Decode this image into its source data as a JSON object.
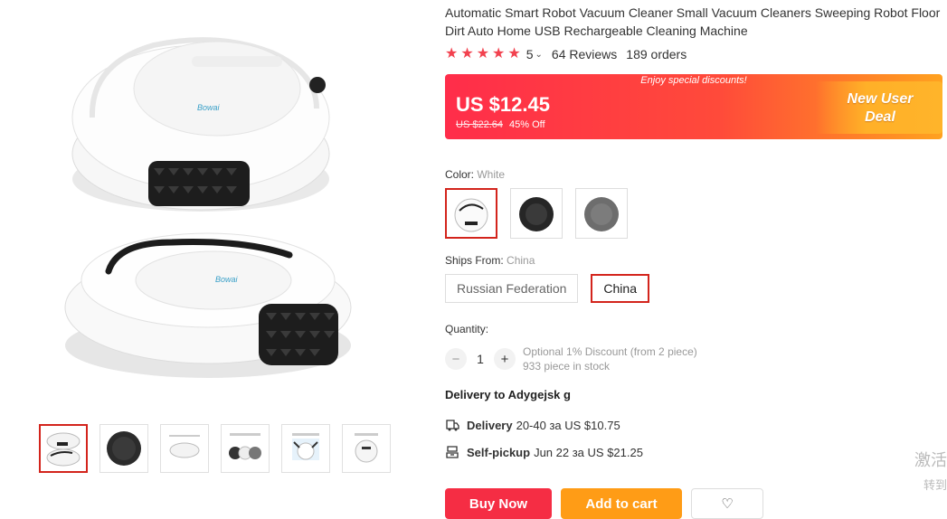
{
  "product": {
    "title": "Automatic Smart Robot Vacuum Cleaner Small Vacuum Cleaners Sweeping Robot Floor Dirt Auto Home USB Rechargeable Cleaning Machine",
    "brand_mark": "Bowai",
    "rating": "5",
    "rating_stars": 5,
    "reviews": "64 Reviews",
    "orders": "189 orders"
  },
  "price": {
    "banner_top": "Enjoy special discounts!",
    "current": "US $12.45",
    "original": "US $22.64",
    "discount": "45% Off",
    "deal_line1": "New User",
    "deal_line2": "Deal"
  },
  "color": {
    "label": "Color:",
    "selected": "White",
    "options": [
      "White",
      "Black",
      "Gray"
    ]
  },
  "ships_from": {
    "label": "Ships From:",
    "selected": "China",
    "options": [
      "Russian Federation",
      "China"
    ]
  },
  "quantity": {
    "label": "Quantity:",
    "value": "1",
    "discount_note": "Optional 1% Discount (from 2 piece)",
    "stock": "933 piece in stock"
  },
  "delivery": {
    "heading": "Delivery to Adygejsk g",
    "courier_label": "Delivery",
    "courier_detail": "20-40 за US $10.75",
    "pickup_label": "Self-pickup",
    "pickup_detail": "Jun 22 за US $21.25"
  },
  "actions": {
    "buy": "Buy Now",
    "cart": "Add to cart"
  },
  "watermark": {
    "line1": "激活",
    "line2": "转到"
  },
  "colors": {
    "accent_red": "#d3241c",
    "banner_red": "#ff2d4a",
    "banner_orange": "#ffa21f",
    "star": "#f2424f"
  }
}
